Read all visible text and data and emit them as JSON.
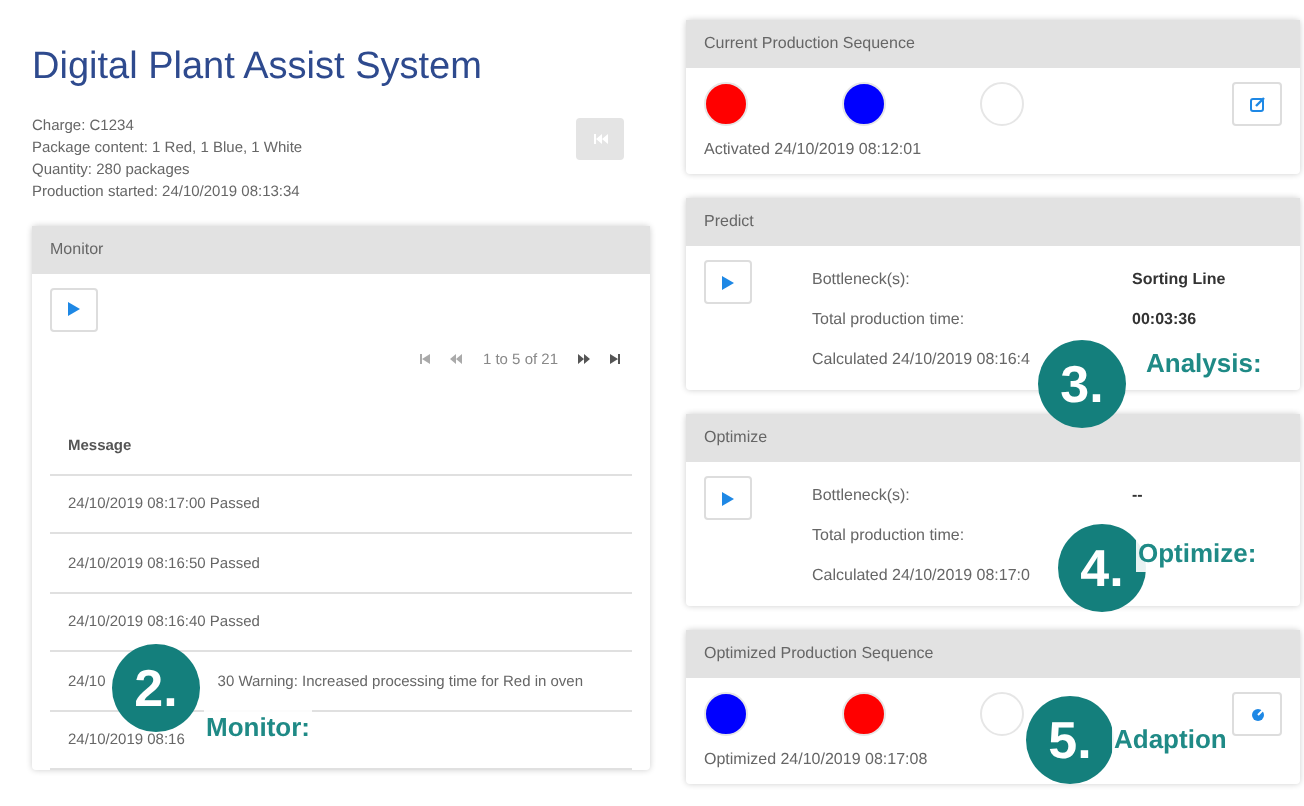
{
  "title": "Digital Plant Assist System",
  "info": [
    "Charge: C1234",
    "Package content: 1 Red, 1 Blue, 1 White",
    "Quantity: 280 packages",
    "Production started: 24/10/2019 08:13:34"
  ],
  "monitor": {
    "title": "Monitor",
    "pager": "1 to 5 of 21",
    "column": "Message",
    "rows": [
      [
        "24/10/2019 08:17:00 Passed"
      ],
      [
        "24/10/2019 08:16:50 Passed"
      ],
      [
        "24/10/2019 08:16:40 Passed"
      ],
      [
        "24/10",
        "30 Warning: Increased processing time for Red in oven"
      ],
      [
        "24/10/2019 08:16"
      ]
    ]
  },
  "current_sequence": {
    "title": "Current Production Sequence",
    "dots": [
      {
        "color": "#ff0000"
      },
      {
        "color": "#0000ff"
      },
      {
        "color": "#ffffff"
      }
    ],
    "status": "Activated 24/10/2019 08:12:01"
  },
  "predict": {
    "title": "Predict",
    "fields": [
      {
        "label": "Bottleneck(s):",
        "value": "Sorting Line"
      },
      {
        "label": "Total production time:",
        "value": "00:03:36"
      }
    ],
    "status": "Calculated 24/10/2019 08:16:4"
  },
  "optimize": {
    "title": "Optimize",
    "fields": [
      {
        "label": "Bottleneck(s):",
        "value": "--"
      },
      {
        "label": "Total production time:"
      }
    ],
    "status": "Calculated 24/10/2019 08:17:0"
  },
  "optimized_sequence": {
    "title": "Optimized Production Sequence",
    "dots": [
      {
        "color": "#0000ff"
      },
      {
        "color": "#ff0000"
      },
      {
        "color": "#ffffff"
      }
    ],
    "status": "Optimized 24/10/2019 08:17:08"
  },
  "annotations": [
    {
      "number": "2.",
      "label": "Monitor:"
    },
    {
      "number": "3.",
      "label": "Analysis:"
    },
    {
      "number": "4.",
      "label": "Optimize:"
    },
    {
      "number": "5.",
      "label": "Adaption"
    }
  ]
}
